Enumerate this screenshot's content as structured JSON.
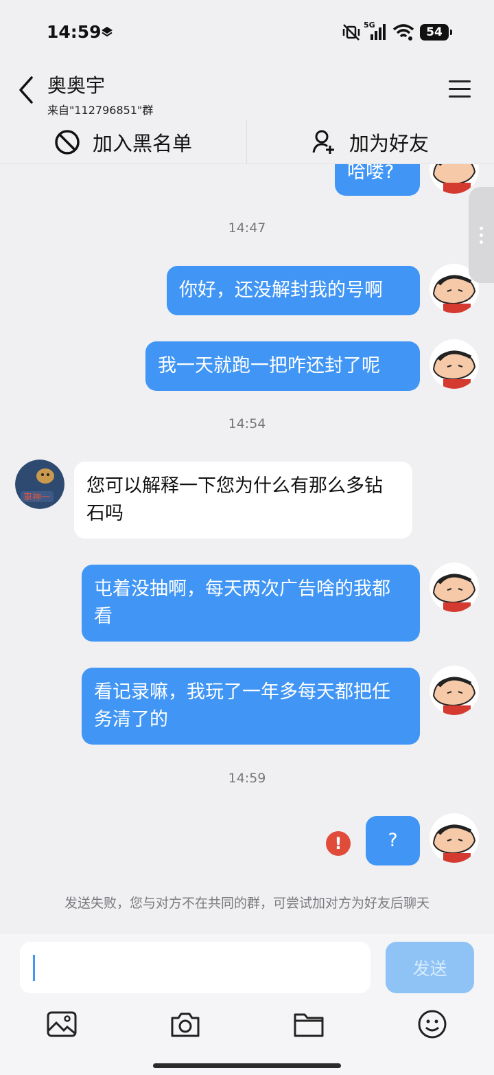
{
  "status_bar": {
    "time": "14:59",
    "network": "5G",
    "battery": "54"
  },
  "header": {
    "contact_name": "奥奥宇",
    "source": "来自\"112796851\"群"
  },
  "actions": {
    "block_label": "加入黑名单",
    "add_friend_label": "加为好友"
  },
  "messages": {
    "m0": "哈喽?",
    "t1": "14:47",
    "m1": "你好，还没解封我的号啊",
    "m2": "我一天就跑一把咋还封了呢",
    "t2": "14:54",
    "m3": "您可以解释一下您为什么有那么多钻石吗",
    "m4": "屯着没抽啊，每天两次广告啥的我都看",
    "m5": "看记录嘛，我玩了一年多每天都把任务清了的",
    "t3": "14:59",
    "m6": "?",
    "error_mark": "!",
    "fail_note": "发送失败，您与对方不在共同的群，可尝试加对方为好友后聊天"
  },
  "incoming_avatar_text": "車神一",
  "input": {
    "value": "",
    "send_label": "发送"
  },
  "toolbar": {
    "icons": [
      "image-icon",
      "camera-icon",
      "folder-icon",
      "emoji-icon"
    ]
  },
  "colors": {
    "bubble_out": "#4196f5",
    "bubble_in": "#ffffff",
    "background": "#f0f0f2",
    "error": "#e04b3a",
    "send_disabled": "#8fc3f6"
  }
}
